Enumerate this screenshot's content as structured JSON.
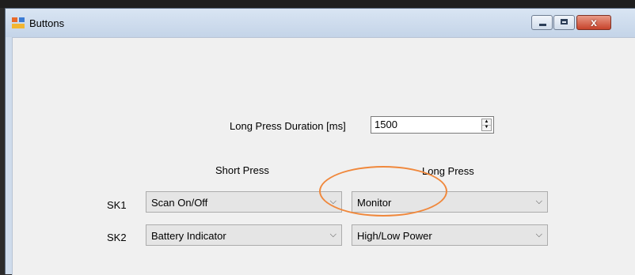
{
  "window": {
    "title": "Buttons",
    "close_glyph": "x"
  },
  "form": {
    "duration_label": "Long Press Duration [ms]",
    "duration_value": "1500",
    "short_press_header": "Short Press",
    "long_press_header": "Long Press",
    "rows": [
      {
        "label": "SK1",
        "short_press": "Scan On/Off",
        "long_press": "Monitor"
      },
      {
        "label": "SK2",
        "short_press": "Battery Indicator",
        "long_press": "High/Low Power"
      }
    ]
  },
  "icons": {
    "dropdown": "chevron-down-icon",
    "spin_up": "▲",
    "spin_down": "▼",
    "chevron": "⌵"
  },
  "colors": {
    "highlight_annotation": "#f0883c",
    "titlebar": "#cfdcec",
    "client_background": "#f0f0f0"
  }
}
